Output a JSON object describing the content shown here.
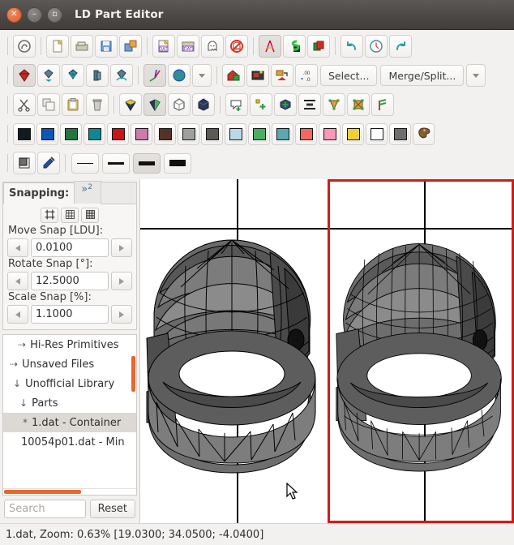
{
  "window": {
    "title": "LD Part Editor",
    "buttons": {
      "close": "close-button",
      "minimize": "minimize-button",
      "maximize": "maximize-button"
    }
  },
  "toolbars": {
    "row1": [
      {
        "name": "logo-button",
        "icon": "ldpe-logo-icon",
        "framed": true,
        "sep_before": true
      },
      {
        "name": "new-file-button",
        "icon": "new-file-icon",
        "framed": true,
        "sep_before": true
      },
      {
        "name": "open-file-button",
        "icon": "open-folder-icon",
        "framed": true
      },
      {
        "name": "save-button",
        "icon": "save-disk-icon",
        "framed": true
      },
      {
        "name": "save-as-button",
        "icon": "save-as-icon",
        "framed": true
      },
      {
        "name": "open-dat-button",
        "icon": "dat-file-icon",
        "framed": true,
        "sep_before": true
      },
      {
        "name": "open-dat-folder-button",
        "icon": "dat-folder-icon",
        "framed": true
      },
      {
        "name": "ghost-button",
        "icon": "ghost-icon",
        "framed": true
      },
      {
        "name": "no-ghost-button",
        "icon": "no-ghost-icon",
        "framed": true
      },
      {
        "name": "compass-button",
        "icon": "compass-icon",
        "framed": true,
        "active": true,
        "sep_before": true
      },
      {
        "name": "snap-s-button",
        "icon": "green-s-icon",
        "framed": true
      },
      {
        "name": "red-cube-button",
        "icon": "red-cube-icon",
        "framed": true
      },
      {
        "name": "undo-button",
        "icon": "undo-arrow-icon",
        "framed": true,
        "sep_before": true
      },
      {
        "name": "history-button",
        "icon": "clock-icon",
        "framed": true
      },
      {
        "name": "redo-button",
        "icon": "redo-arrow-icon",
        "framed": true
      }
    ],
    "row2": [
      {
        "name": "select-mode-button",
        "icon": "red-gem-icon",
        "framed": true,
        "active": true,
        "sep_before": true
      },
      {
        "name": "move-mode-button",
        "icon": "move-gem-icon",
        "framed": true
      },
      {
        "name": "rotate-mode-button",
        "icon": "rotate-gem-icon",
        "framed": true
      },
      {
        "name": "scale-mode-button",
        "icon": "scale-gem-icon",
        "framed": true
      },
      {
        "name": "transform-mode-button",
        "icon": "transform-gem-icon",
        "framed": true
      },
      {
        "name": "axes-button",
        "icon": "axes-icon",
        "framed": true,
        "active": true,
        "sep_before": true
      },
      {
        "name": "globe-button",
        "icon": "globe-icon",
        "framed": true
      },
      {
        "name": "row2-overflow-button",
        "icon": "chevron-down-icon",
        "framed": true,
        "arrow": true
      },
      {
        "name": "insert-primitive-button",
        "icon": "insert-home-icon",
        "framed": true,
        "sep_before": true
      },
      {
        "name": "texmap-button",
        "icon": "texmap-icon",
        "framed": true
      },
      {
        "name": "project-button",
        "icon": "project-icon",
        "framed": true
      },
      {
        "name": "decimal-places-button",
        "icon": "decimal-icon",
        "framed": true
      }
    ],
    "row2_text": [
      {
        "name": "select-menu-button",
        "label": "Select..."
      },
      {
        "name": "merge-split-menu-button",
        "label": "Merge/Split..."
      },
      {
        "name": "row2-text-overflow-button",
        "icon": "chevron-down-icon",
        "arrow": true
      }
    ],
    "row3": [
      {
        "name": "cut-button",
        "icon": "scissors-icon",
        "framed": true,
        "sep_before": true
      },
      {
        "name": "copy-button",
        "icon": "copy-icon",
        "framed": true
      },
      {
        "name": "paste-button",
        "icon": "clipboard-icon",
        "framed": true
      },
      {
        "name": "delete-button",
        "icon": "trash-icon",
        "framed": true
      },
      {
        "name": "bfc-front-button",
        "icon": "bfc-front-icon",
        "framed": true,
        "sep_before": true
      },
      {
        "name": "bfc-back-button",
        "icon": "bfc-back-icon",
        "framed": true,
        "active": true
      },
      {
        "name": "wireframe-button",
        "icon": "wireframe-cube-icon",
        "framed": true
      },
      {
        "name": "solid-button",
        "icon": "solid-cube-icon",
        "framed": true
      },
      {
        "name": "add-comment-button",
        "icon": "add-comment-icon",
        "framed": true,
        "sep_before": true
      },
      {
        "name": "add-vertex-button",
        "icon": "add-vertex-icon",
        "framed": true
      },
      {
        "name": "add-primitive-button",
        "icon": "add-primitive-icon",
        "framed": true
      },
      {
        "name": "align-button",
        "icon": "align-icon",
        "framed": true
      },
      {
        "name": "mesh-reduce-button",
        "icon": "mesh-reduce-icon",
        "framed": true
      },
      {
        "name": "mesh-split-button",
        "icon": "mesh-split-icon",
        "framed": true
      },
      {
        "name": "rectifier-button",
        "icon": "rectifier-icon",
        "framed": true
      }
    ],
    "colors": [
      {
        "name": "color-black",
        "hex": "#111b22"
      },
      {
        "name": "color-blue",
        "hex": "#0a56b6"
      },
      {
        "name": "color-green",
        "hex": "#22753f"
      },
      {
        "name": "color-dark-turquoise",
        "hex": "#0a8894"
      },
      {
        "name": "color-red",
        "hex": "#c81414"
      },
      {
        "name": "color-dark-pink",
        "hex": "#cd7baa"
      },
      {
        "name": "color-brown",
        "hex": "#543324"
      },
      {
        "name": "color-light-gray",
        "hex": "#9ba19e"
      },
      {
        "name": "color-dark-gray",
        "hex": "#5b5b55"
      },
      {
        "name": "color-light-blue",
        "hex": "#bed8e8"
      },
      {
        "name": "color-bright-green",
        "hex": "#4cae62"
      },
      {
        "name": "color-light-turquoise",
        "hex": "#5aa8b4"
      },
      {
        "name": "color-salmon",
        "hex": "#f0685f"
      },
      {
        "name": "color-pink",
        "hex": "#fc96b9"
      },
      {
        "name": "color-yellow",
        "hex": "#f2cd38"
      },
      {
        "name": "color-white",
        "hex": "#ffffff"
      },
      {
        "name": "color-gray",
        "hex": "#6e6e6e"
      }
    ],
    "palette_button": {
      "name": "color-palette-button",
      "icon": "palette-icon"
    },
    "row5": [
      {
        "name": "fill-color-button",
        "icon": "filled-square-icon",
        "framed": true,
        "sep_before": true
      },
      {
        "name": "pipette-button",
        "icon": "pipette-icon",
        "framed": true
      },
      {
        "name": "line-width-1-button",
        "icon": "line-thin-icon",
        "w": 1,
        "sep_before": true
      },
      {
        "name": "line-width-2-button",
        "icon": "line-medium-icon",
        "w": 3
      },
      {
        "name": "line-width-3-button",
        "icon": "line-thick-icon",
        "w": 5,
        "active": true
      },
      {
        "name": "line-width-4-button",
        "icon": "line-extra-thick-icon",
        "w": 8
      }
    ]
  },
  "snapping": {
    "tab_label": "Snapping:",
    "overflow_tab": "»",
    "overflow_count": "2",
    "grid_buttons": [
      {
        "name": "grid-coarse-button",
        "icon": "grid-coarse-icon"
      },
      {
        "name": "grid-medium-button",
        "icon": "grid-medium-icon"
      },
      {
        "name": "grid-fine-button",
        "icon": "grid-fine-icon"
      }
    ],
    "fields": [
      {
        "name": "move-snap",
        "label": "Move Snap [LDU]:",
        "value": "0.0100"
      },
      {
        "name": "rotate-snap",
        "label": "Rotate Snap [°]:",
        "value": "12.5000"
      },
      {
        "name": "scale-snap",
        "label": "Scale Snap [%]:",
        "value": "1.1000"
      }
    ]
  },
  "tree": {
    "items": [
      {
        "name": "tree-item-hi-res-primitives",
        "arrow": "⇢",
        "label": "Hi-Res Primitives",
        "indent": 18,
        "selected": false
      },
      {
        "name": "tree-item-unsaved-files",
        "arrow": "⇢",
        "label": "Unsaved Files",
        "indent": 8,
        "selected": false
      },
      {
        "name": "tree-item-unofficial-library",
        "arrow": "↓",
        "label": "Unofficial Library",
        "indent": 12,
        "selected": false
      },
      {
        "name": "tree-item-parts",
        "arrow": "↓",
        "label": "Parts",
        "indent": 20,
        "selected": false
      },
      {
        "name": "tree-item-1dat-container",
        "arrow": "*",
        "label": "1.dat - Container",
        "indent": 24,
        "selected": true
      },
      {
        "name": "tree-item-10054p01",
        "arrow": "",
        "label": "10054p01.dat - Min",
        "indent": 22,
        "selected": false
      }
    ],
    "search": {
      "name": "search-input",
      "placeholder": "Search",
      "value": ""
    },
    "reset": {
      "name": "reset-button",
      "label": "Reset"
    }
  },
  "viewports": {
    "left": {
      "name": "viewport-left",
      "selected": false
    },
    "right": {
      "name": "viewport-right",
      "selected": true,
      "border_color": "#d21c18"
    }
  },
  "status": {
    "text": "1.dat, Zoom: 0.63% [19.0300; 34.0500; -4.0400]"
  }
}
